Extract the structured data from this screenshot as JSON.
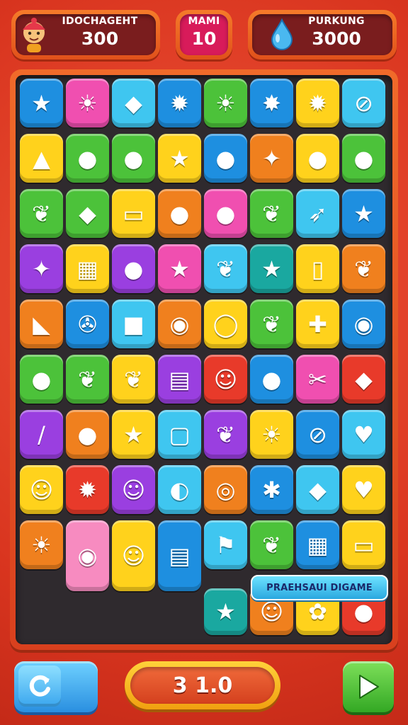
{
  "hud": {
    "left": {
      "label": "IDOCHAGEHT",
      "value": "300"
    },
    "middle": {
      "label": "MAMI",
      "value": "10"
    },
    "right": {
      "label": "PURKUNG",
      "value": "3000"
    }
  },
  "board": {
    "banner": "PRAEHSAUI DIGAME",
    "tiles": [
      {
        "color": "#1e8fe0",
        "glyph": "★",
        "icon": "star-icon"
      },
      {
        "color": "#f04fb0",
        "glyph": "☀",
        "icon": "sun-icon"
      },
      {
        "color": "#3fc6f0",
        "glyph": "◆",
        "icon": "kite-icon"
      },
      {
        "color": "#1e8fe0",
        "glyph": "✹",
        "icon": "spiky-ball-icon"
      },
      {
        "color": "#4cc23a",
        "glyph": "☀",
        "icon": "sun-icon"
      },
      {
        "color": "#1e8fe0",
        "glyph": "✸",
        "icon": "sun-icon"
      },
      {
        "color": "#ffd21c",
        "glyph": "✹",
        "icon": "spiky-ball-icon"
      },
      {
        "color": "#3fc6f0",
        "glyph": "⊘",
        "icon": "no-sign-icon"
      },
      {
        "color": "#ffd21c",
        "glyph": "▲",
        "icon": "hat-icon"
      },
      {
        "color": "#4cc23a",
        "glyph": "●",
        "icon": "egg-icon"
      },
      {
        "color": "#4cc23a",
        "glyph": "●",
        "icon": "lemon-icon"
      },
      {
        "color": "#ffd21c",
        "glyph": "★",
        "icon": "star-icon"
      },
      {
        "color": "#1e8fe0",
        "glyph": "●",
        "icon": "lollipop-icon"
      },
      {
        "color": "#f0801e",
        "glyph": "✦",
        "icon": "leaf-icon"
      },
      {
        "color": "#ffd21c",
        "glyph": "●",
        "icon": "apple-icon"
      },
      {
        "color": "#4cc23a",
        "glyph": "●",
        "icon": "orange-icon"
      },
      {
        "color": "#4cc23a",
        "glyph": "❦",
        "icon": "leaf-icon"
      },
      {
        "color": "#4cc23a",
        "glyph": "◆",
        "icon": "lemon-icon"
      },
      {
        "color": "#ffd21c",
        "glyph": "▭",
        "icon": "laptop-icon"
      },
      {
        "color": "#f0801e",
        "glyph": "●",
        "icon": "berry-icon"
      },
      {
        "color": "#f04fb0",
        "glyph": "●",
        "icon": "peach-icon"
      },
      {
        "color": "#4cc23a",
        "glyph": "❦",
        "icon": "leaf-icon"
      },
      {
        "color": "#3fc6f0",
        "glyph": "➶",
        "icon": "arrow-icon"
      },
      {
        "color": "#1e8fe0",
        "glyph": "★",
        "icon": "star-icon"
      },
      {
        "color": "#9a3fe0",
        "glyph": "✦",
        "icon": "sparkle-icon"
      },
      {
        "color": "#ffd21c",
        "glyph": "▦",
        "icon": "calendar-icon"
      },
      {
        "color": "#9a3fe0",
        "glyph": "●",
        "icon": "ice-cream-icon"
      },
      {
        "color": "#f04fb0",
        "glyph": "★",
        "icon": "star-icon"
      },
      {
        "color": "#3fc6f0",
        "glyph": "❦",
        "icon": "leaf-icon"
      },
      {
        "color": "#1aa8a0",
        "glyph": "★",
        "icon": "star-icon"
      },
      {
        "color": "#ffd21c",
        "glyph": "▯",
        "icon": "phone-icon"
      },
      {
        "color": "#f0801e",
        "glyph": "❦",
        "icon": "leaf-icon"
      },
      {
        "color": "#f0801e",
        "glyph": "◣",
        "icon": "bell-icon"
      },
      {
        "color": "#1e8fe0",
        "glyph": "✇",
        "icon": "axe-icon"
      },
      {
        "color": "#3fc6f0",
        "glyph": "■",
        "icon": "box-icon"
      },
      {
        "color": "#f0801e",
        "glyph": "◉",
        "icon": "ring-icon"
      },
      {
        "color": "#ffd21c",
        "glyph": "◯",
        "icon": "ring-icon"
      },
      {
        "color": "#4cc23a",
        "glyph": "❦",
        "icon": "leaf-icon"
      },
      {
        "color": "#ffd21c",
        "glyph": "✚",
        "icon": "pin-icon"
      },
      {
        "color": "#1e8fe0",
        "glyph": "◉",
        "icon": "orb-icon"
      },
      {
        "color": "#4cc23a",
        "glyph": "●",
        "icon": "balloon-icon"
      },
      {
        "color": "#4cc23a",
        "glyph": "❦",
        "icon": "leaf-icon"
      },
      {
        "color": "#ffd21c",
        "glyph": "❦",
        "icon": "leaf-icon"
      },
      {
        "color": "#9a3fe0",
        "glyph": "▤",
        "icon": "window-icon"
      },
      {
        "color": "#e83a2a",
        "glyph": "☺",
        "icon": "cat-face-icon"
      },
      {
        "color": "#1e8fe0",
        "glyph": "●",
        "icon": "balloon-icon"
      },
      {
        "color": "#f04fb0",
        "glyph": "✂",
        "icon": "scissors-icon"
      },
      {
        "color": "#e83a2a",
        "glyph": "◆",
        "icon": "corn-icon"
      },
      {
        "color": "#9a3fe0",
        "glyph": "/",
        "icon": "ice-pop-icon"
      },
      {
        "color": "#f0801e",
        "glyph": "●",
        "icon": "bell-icon"
      },
      {
        "color": "#ffd21c",
        "glyph": "★",
        "icon": "star-icon"
      },
      {
        "color": "#3fc6f0",
        "glyph": "▢",
        "icon": "frame-icon"
      },
      {
        "color": "#9a3fe0",
        "glyph": "❦",
        "icon": "leaf-icon"
      },
      {
        "color": "#ffd21c",
        "glyph": "☀",
        "icon": "sun-icon"
      },
      {
        "color": "#1e8fe0",
        "glyph": "⊘",
        "icon": "no-sign-icon"
      },
      {
        "color": "#3fc6f0",
        "glyph": "♥",
        "icon": "heart-icon"
      },
      {
        "color": "#ffd21c",
        "glyph": "☺",
        "icon": "ghost-icon"
      },
      {
        "color": "#e83a2a",
        "glyph": "✹",
        "icon": "virus-icon"
      },
      {
        "color": "#9a3fe0",
        "glyph": "☺",
        "icon": "face-icon"
      },
      {
        "color": "#3fc6f0",
        "glyph": "◐",
        "icon": "moon-icon"
      },
      {
        "color": "#f0801e",
        "glyph": "◎",
        "icon": "swirl-icon"
      },
      {
        "color": "#1e8fe0",
        "glyph": "✱",
        "icon": "snowflake-icon"
      },
      {
        "color": "#3fc6f0",
        "glyph": "◆",
        "icon": "banana-icon"
      },
      {
        "color": "#ffd21c",
        "glyph": "♥",
        "icon": "heart-icon"
      },
      {
        "color": "#f0801e",
        "glyph": "☀",
        "icon": "sun-icon"
      },
      {
        "color": "#f78bc0",
        "glyph": "◉",
        "icon": "ring-icon"
      },
      {
        "color": "#ffd21c",
        "glyph": "☺",
        "icon": "cat-icon"
      },
      {
        "color": "#1e8fe0",
        "glyph": "▤",
        "icon": "crate-icon"
      },
      {
        "color": "#3fc6f0",
        "glyph": "⚑",
        "icon": "flag-icon"
      },
      {
        "color": "#4cc23a",
        "glyph": "❦",
        "icon": "leaf-icon"
      },
      {
        "color": "#1e8fe0",
        "glyph": "▦",
        "icon": "window-icon"
      },
      {
        "color": "#ffd21c",
        "glyph": "▭",
        "icon": "bus-icon"
      },
      {
        "color": "#1aa8a0",
        "glyph": "★",
        "icon": "star-icon"
      },
      {
        "color": "#f0801e",
        "glyph": "☺",
        "icon": "bear-icon"
      },
      {
        "color": "#ffd21c",
        "glyph": "✿",
        "icon": "flower-icon"
      },
      {
        "color": "#e83a2a",
        "glyph": "●",
        "icon": "balloon-icon"
      }
    ]
  },
  "controls": {
    "score": "3 1.0"
  },
  "colors": {
    "accent": "#e8402a",
    "board_well": "#2f2a2e"
  }
}
